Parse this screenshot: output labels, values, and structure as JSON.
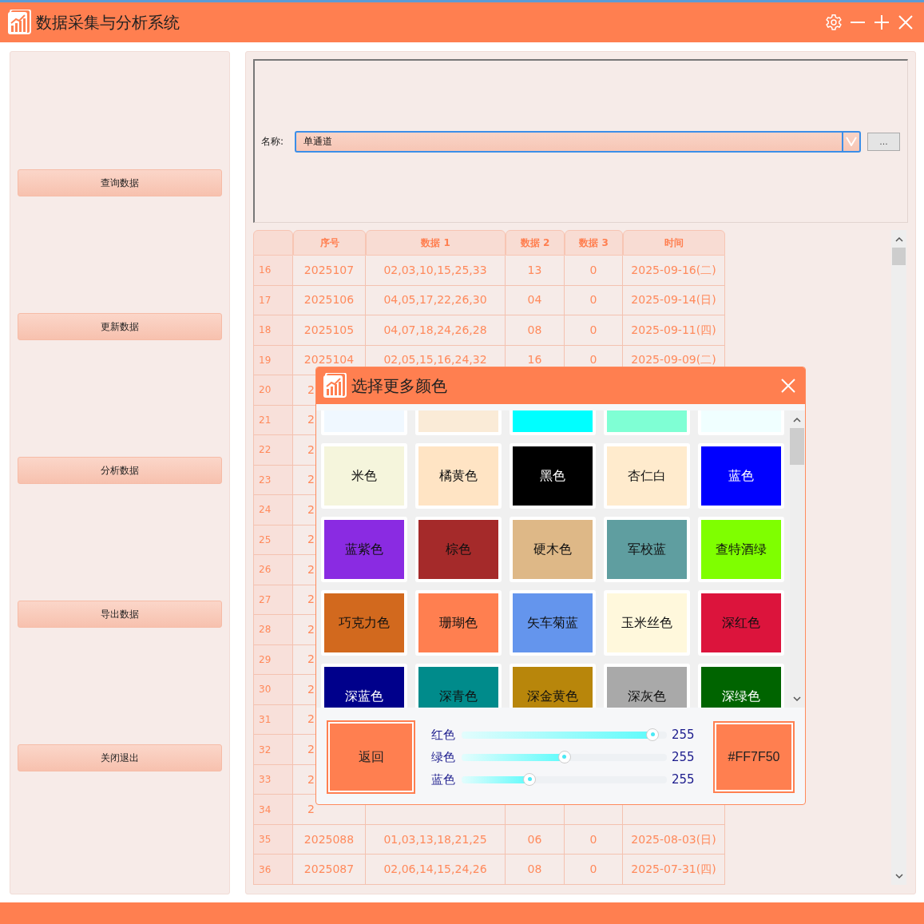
{
  "window": {
    "title": "数据采集与分析系统"
  },
  "sidebar": {
    "buttons": [
      "查询数据",
      "更新数据",
      "分析数据",
      "导出数据",
      "关闭退出"
    ]
  },
  "form": {
    "label": "名称:",
    "dropdown_value": "单通道",
    "browse_button": "..."
  },
  "table": {
    "columns": [
      "",
      "序号",
      "数据 1",
      "数据 2",
      "数据 3",
      "时间"
    ],
    "rows": [
      {
        "kind": "full",
        "index": "16",
        "seq": "2025107",
        "data1": "02,03,10,15,25,33",
        "data2": "13",
        "data3": "0",
        "time": "2025-09-16(二)"
      },
      {
        "kind": "full",
        "index": "17",
        "seq": "2025106",
        "data1": "04,05,17,22,26,30",
        "data2": "04",
        "data3": "0",
        "time": "2025-09-14(日)"
      },
      {
        "kind": "full",
        "index": "18",
        "seq": "2025105",
        "data1": "04,07,18,24,26,28",
        "data2": "08",
        "data3": "0",
        "time": "2025-09-11(四)"
      },
      {
        "kind": "full",
        "index": "19",
        "seq": "2025104",
        "data1": "02,05,15,16,24,32",
        "data2": "16",
        "data3": "0",
        "time": "2025-09-09(二)"
      },
      {
        "kind": "covered",
        "index": "20",
        "seq": "2"
      },
      {
        "kind": "covered",
        "index": "21",
        "seq": "2"
      },
      {
        "kind": "covered",
        "index": "22",
        "seq": "2"
      },
      {
        "kind": "covered",
        "index": "23",
        "seq": "2"
      },
      {
        "kind": "covered",
        "index": "24",
        "seq": "2"
      },
      {
        "kind": "covered",
        "index": "25",
        "seq": "2"
      },
      {
        "kind": "covered",
        "index": "26",
        "seq": "2"
      },
      {
        "kind": "covered",
        "index": "27",
        "seq": "2"
      },
      {
        "kind": "covered",
        "index": "28",
        "seq": "2"
      },
      {
        "kind": "covered",
        "index": "29",
        "seq": "2"
      },
      {
        "kind": "covered",
        "index": "30",
        "seq": "2"
      },
      {
        "kind": "covered",
        "index": "31",
        "seq": "2"
      },
      {
        "kind": "covered",
        "index": "32",
        "seq": "2"
      },
      {
        "kind": "covered",
        "index": "33",
        "seq": "2"
      },
      {
        "kind": "covered",
        "index": "34",
        "seq": "2"
      },
      {
        "kind": "full",
        "index": "35",
        "seq": "2025088",
        "data1": "01,03,13,18,21,25",
        "data2": "06",
        "data3": "0",
        "time": "2025-08-03(日)"
      },
      {
        "kind": "full",
        "index": "36",
        "seq": "2025087",
        "data1": "02,06,14,15,24,26",
        "data2": "08",
        "data3": "0",
        "time": "2025-07-31(四)"
      }
    ]
  },
  "dialog": {
    "title": "选择更多颜色",
    "swatches": [
      {
        "color": "#f0f8ff"
      },
      {
        "color": "#faebd7"
      },
      {
        "color": "#00ffff"
      },
      {
        "color": "#7fffd4"
      },
      {
        "color": "#f0ffff"
      },
      {
        "label": "米色",
        "color": "#f5f5dc"
      },
      {
        "label": "橘黄色",
        "color": "#ffe4c4"
      },
      {
        "label": "黑色",
        "color": "#000000"
      },
      {
        "label": "杏仁白",
        "color": "#ffebcd"
      },
      {
        "label": "蓝色",
        "color": "#0000ff"
      },
      {
        "label": "蓝紫色",
        "color": "#8a2be2"
      },
      {
        "label": "棕色",
        "color": "#a52a2a"
      },
      {
        "label": "硬木色",
        "color": "#deb887"
      },
      {
        "label": "军校蓝",
        "color": "#5f9ea0"
      },
      {
        "label": "查特酒绿",
        "color": "#7fff00"
      },
      {
        "label": "巧克力色",
        "color": "#d2691e"
      },
      {
        "label": "珊瑚色",
        "color": "#ff7f50"
      },
      {
        "label": "矢车菊蓝",
        "color": "#6495ed"
      },
      {
        "label": "玉米丝色",
        "color": "#fff8dc"
      },
      {
        "label": "深红色",
        "color": "#dc143c"
      },
      {
        "label": "深蓝色",
        "color": "#00008b"
      },
      {
        "label": "深青色",
        "color": "#008b8b"
      },
      {
        "label": "深金黄色",
        "color": "#b8860b"
      },
      {
        "label": "深灰色",
        "color": "#a9a9a9"
      },
      {
        "label": "深绿色",
        "color": "#006400"
      }
    ],
    "back_button": "返回",
    "sliders": [
      {
        "label": "红色",
        "level": 0.96,
        "reading": "255"
      },
      {
        "label": "绿色",
        "level": 0.5,
        "reading": "255"
      },
      {
        "label": "蓝色",
        "level": 0.32,
        "reading": "255"
      }
    ],
    "hex_button": "#FF7F50"
  }
}
